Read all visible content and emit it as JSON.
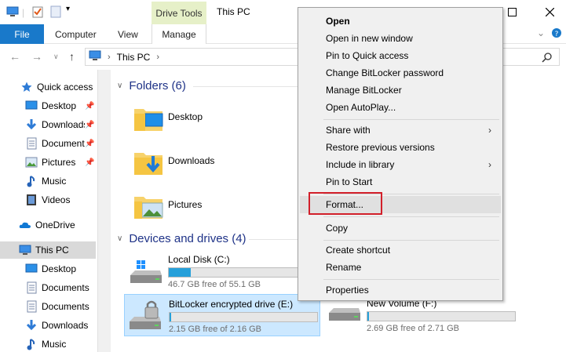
{
  "titlebar": {
    "context_tab": "Drive Tools",
    "title": "This PC"
  },
  "ribbon": {
    "tabs": [
      "File",
      "Computer",
      "View",
      "Manage"
    ],
    "expand_icon": "chevron-down-icon",
    "help_icon": "help-icon"
  },
  "address": {
    "path": "This PC",
    "search_icon": "search-icon"
  },
  "sidebar": {
    "items": [
      {
        "label": "Quick access",
        "icon": "star-icon",
        "pinned": false
      },
      {
        "label": "Desktop",
        "icon": "desktop-icon",
        "pinned": true
      },
      {
        "label": "Downloads",
        "icon": "download-icon",
        "pinned": true
      },
      {
        "label": "Documents",
        "icon": "document-icon",
        "pinned": true
      },
      {
        "label": "Pictures",
        "icon": "pictures-icon",
        "pinned": true
      },
      {
        "label": "Music",
        "icon": "music-icon",
        "pinned": false
      },
      {
        "label": "Videos",
        "icon": "video-icon",
        "pinned": false
      },
      {
        "label": "OneDrive",
        "icon": "cloud-icon",
        "pinned": false
      },
      {
        "label": "This PC",
        "icon": "computer-icon",
        "pinned": false
      },
      {
        "label": "Desktop",
        "icon": "desktop-icon",
        "pinned": false
      },
      {
        "label": "Documents",
        "icon": "document-icon",
        "pinned": false
      },
      {
        "label": "Documents",
        "icon": "document-icon",
        "pinned": false
      },
      {
        "label": "Downloads",
        "icon": "download-icon",
        "pinned": false
      },
      {
        "label": "Music",
        "icon": "music-icon",
        "pinned": false
      }
    ]
  },
  "main": {
    "folders_header": "Folders (6)",
    "folders": [
      "Desktop",
      "Downloads",
      "Pictures"
    ],
    "drives_header": "Devices and drives (4)",
    "drives": [
      {
        "name": "Local Disk (C:)",
        "free": "46.7 GB free of 55.1 GB",
        "used_fraction": 0.15
      },
      {
        "name": "BitLocker encrypted drive (E:)",
        "free": "2.15 GB free of 2.16 GB",
        "used_fraction": 0.01
      },
      {
        "name": "New Volume (F:)",
        "free": "2.69 GB free of 2.71 GB",
        "used_fraction": 0.01
      }
    ]
  },
  "context_menu": {
    "items": [
      "Open",
      "Open in new window",
      "Pin to Quick access",
      "Change BitLocker password",
      "Manage BitLocker",
      "Open AutoPlay...",
      "Share with",
      "Restore previous versions",
      "Include in library",
      "Pin to Start",
      "Format...",
      "Copy",
      "Create shortcut",
      "Rename",
      "Properties"
    ]
  }
}
